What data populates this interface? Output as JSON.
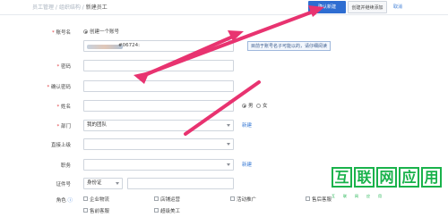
{
  "header": {
    "breadcrumb": [
      "员工管理",
      "组织结构",
      "新建员工"
    ],
    "confirm_button": "确认新建",
    "save_continue_button": "创建并继续添加",
    "cancel_button": "取消"
  },
  "form": {
    "account": {
      "label": "账号名",
      "mode_option": "创建一个账号",
      "value_suffix": "#06724:",
      "hint": "目前于账号名子可能以的，请仔细阅读"
    },
    "password": {
      "label": "密码",
      "value": ""
    },
    "confirm_password": {
      "label": "确认密码",
      "value": ""
    },
    "name": {
      "label": "姓名",
      "value": ""
    },
    "gender": {
      "options": [
        "男",
        "女"
      ],
      "selected": "男"
    },
    "department": {
      "label": "部门",
      "value": "我的团队",
      "new_link": "新建"
    },
    "superior": {
      "label": "直接上级",
      "value": ""
    },
    "position": {
      "label": "职务",
      "value": "",
      "new_link": "新建"
    },
    "id_card": {
      "label": "证件号",
      "type_value": "身份证",
      "number_value": ""
    },
    "roles": {
      "label": "角色",
      "items": [
        "企业物流",
        "店铺运营",
        "活动推广",
        "售后客服",
        "售前客服",
        "超级美工"
      ]
    }
  },
  "watermark": {
    "chars": [
      "互",
      "联",
      "网",
      "应",
      "用"
    ],
    "subtitle": "互联网应用"
  },
  "colors": {
    "primary": "#2e6dd1",
    "link": "#3a7bd5",
    "required": "#e0393e",
    "watermark": "#19b24b",
    "arrow": "#e83370"
  }
}
